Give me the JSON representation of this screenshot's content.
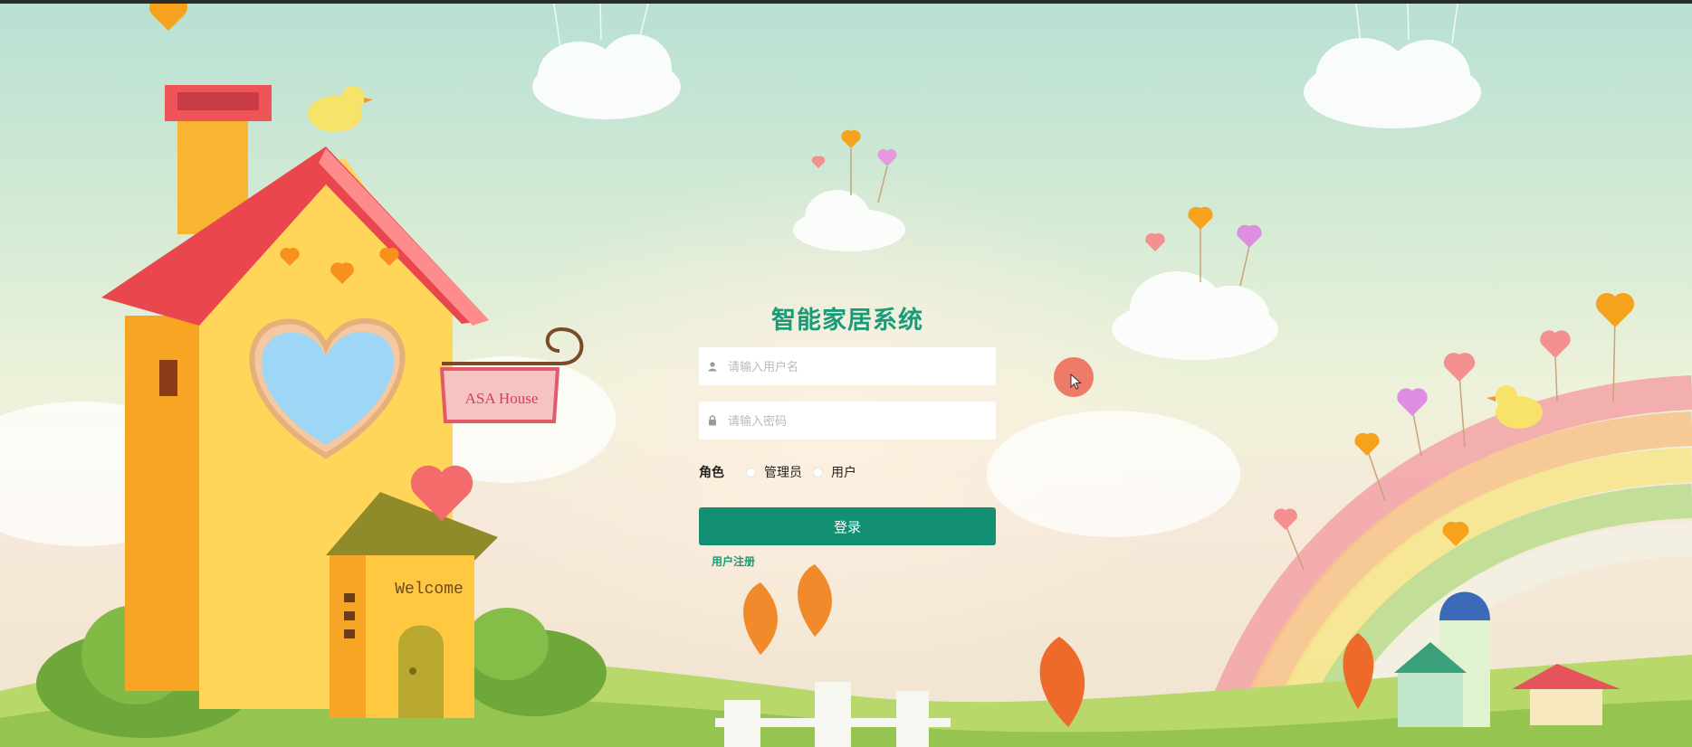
{
  "login": {
    "title": "智能家居系统",
    "username_placeholder": "请输入用户名",
    "password_placeholder": "请输入密码",
    "role_label": "角色",
    "role_options": [
      "管理员",
      "用户"
    ],
    "submit_label": "登录",
    "register_link": "用户注册"
  },
  "illustration": {
    "house_sign": "ASA House",
    "door_sign": "Welcome"
  },
  "colors": {
    "accent": "#1a9a78",
    "button": "#138f73"
  }
}
